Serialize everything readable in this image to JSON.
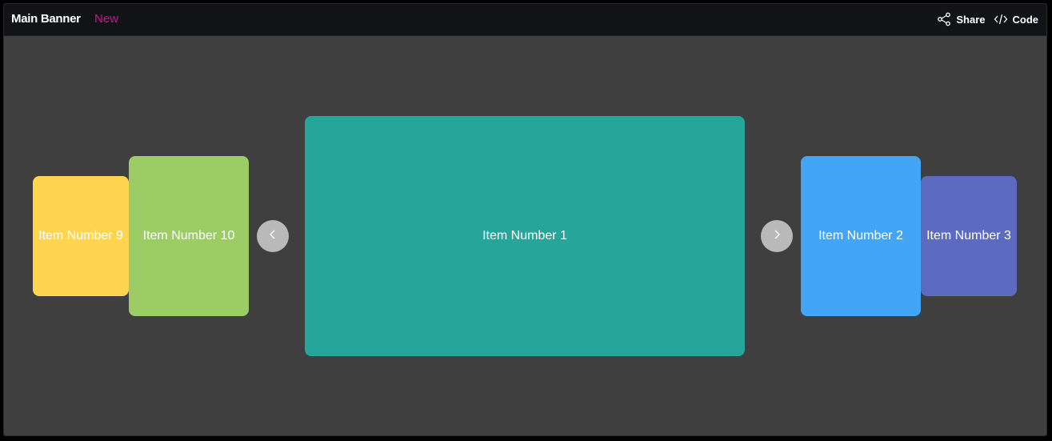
{
  "header": {
    "title": "Main Banner",
    "badge": "New",
    "share_label": "Share",
    "code_label": "Code",
    "share_icon": "share-icon",
    "code_icon": "code-icon",
    "badge_color": "#c2188f"
  },
  "carousel": {
    "prev_icon": "chevron-left-icon",
    "next_icon": "chevron-right-icon",
    "cards": [
      {
        "label": "Item Number 9",
        "color": "#ffd54f",
        "position": "far-left"
      },
      {
        "label": "Item Number 10",
        "color": "#9ccc65",
        "position": "left"
      },
      {
        "label": "Item Number 1",
        "color": "#26a69a",
        "position": "center"
      },
      {
        "label": "Item Number 2",
        "color": "#42a5f5",
        "position": "right"
      },
      {
        "label": "Item Number 3",
        "color": "#5c6bc0",
        "position": "far-right"
      }
    ]
  },
  "colors": {
    "topbar": "#121317",
    "stage": "#3f3f3f",
    "nav_button": "#b9b9b9"
  }
}
